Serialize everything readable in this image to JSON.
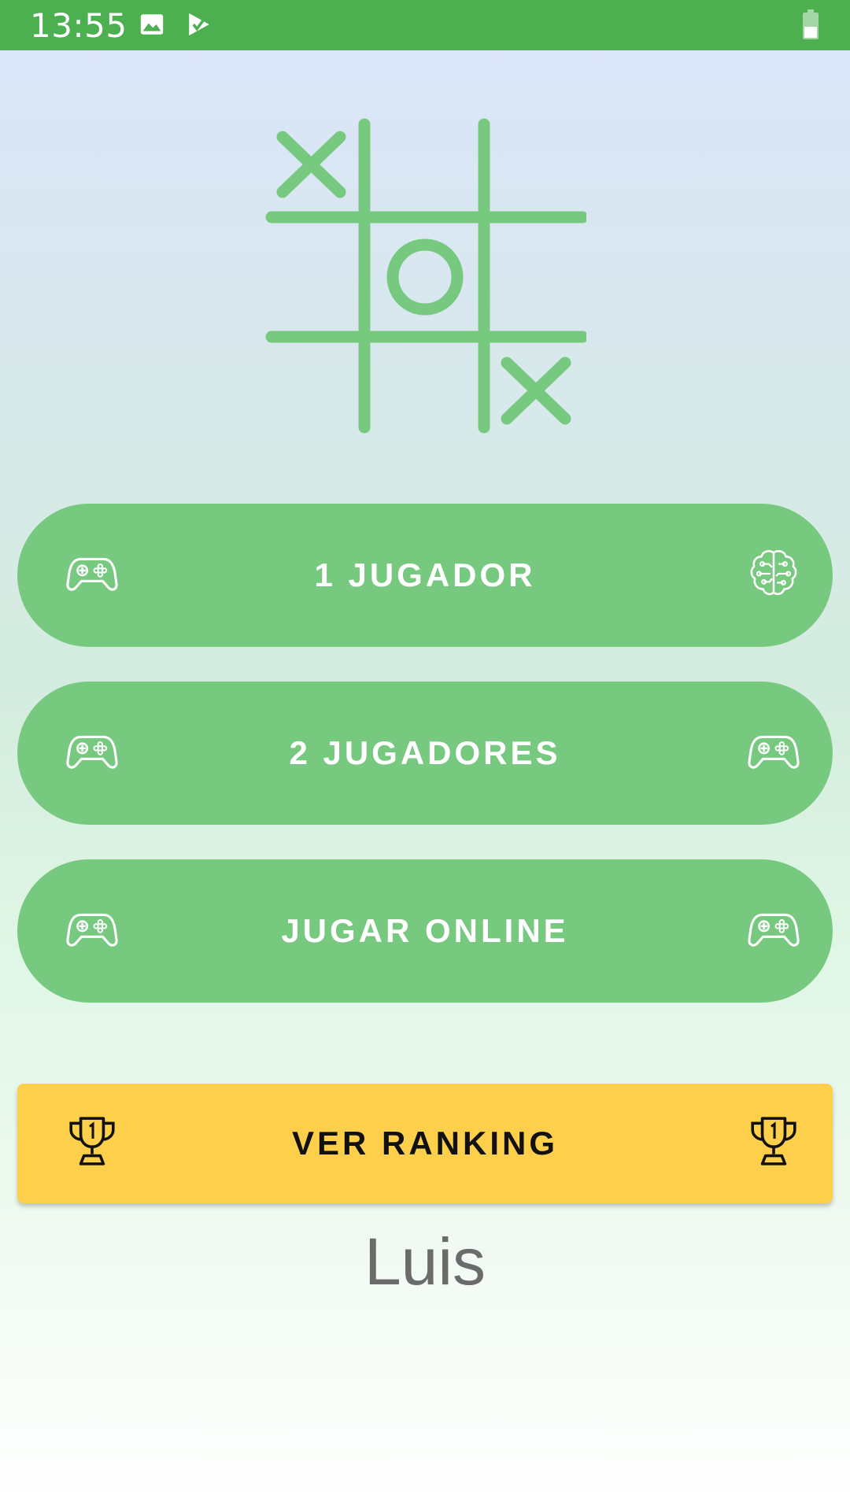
{
  "status_bar": {
    "time": "13:55",
    "icons": [
      "image-icon",
      "play-store-icon",
      "battery-icon"
    ],
    "color": "#4caf50"
  },
  "logo": {
    "icon": "tic-tac-toe-logo",
    "color": "#76c97e"
  },
  "buttons": {
    "one_player": {
      "label": "1 JUGADOR",
      "icon_left": "gamepad-icon",
      "icon_right": "brain-icon"
    },
    "two_players": {
      "label": "2 JUGADORES",
      "icon_left": "gamepad-icon",
      "icon_right": "gamepad-icon"
    },
    "online": {
      "label": "JUGAR ONLINE",
      "icon_left": "gamepad-icon",
      "icon_right": "gamepad-icon"
    },
    "ranking": {
      "label": "VER RANKING",
      "icon_left": "trophy-icon",
      "icon_right": "trophy-icon"
    }
  },
  "user": {
    "name": "Luis"
  },
  "colors": {
    "accent": "#76c97e",
    "ranking": "#fecf4a",
    "username": "#6b6b6b"
  }
}
